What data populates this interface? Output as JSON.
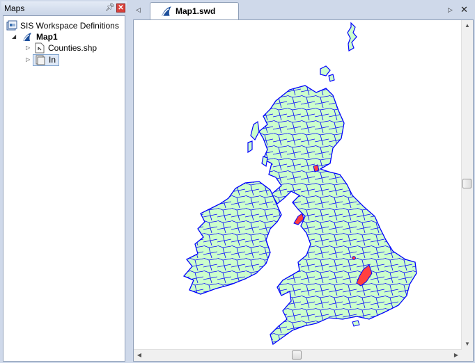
{
  "panel": {
    "title": "Maps",
    "pin_icon": "pin-icon",
    "close_icon": "close-icon"
  },
  "tree": {
    "root_label": "SIS Workspace Definitions",
    "map_label": "Map1",
    "items": [
      {
        "label": "Counties.shp",
        "icon": "shapefile-icon"
      },
      {
        "label": "In",
        "icon": "overlay-icon"
      }
    ]
  },
  "document": {
    "tab_label": "Map1.swd",
    "tab_icon": "map-document-icon"
  },
  "map": {
    "land_fill": "#ccffcc",
    "boundary_color": "#0000ff",
    "highlight_fill": "#ff4040"
  }
}
